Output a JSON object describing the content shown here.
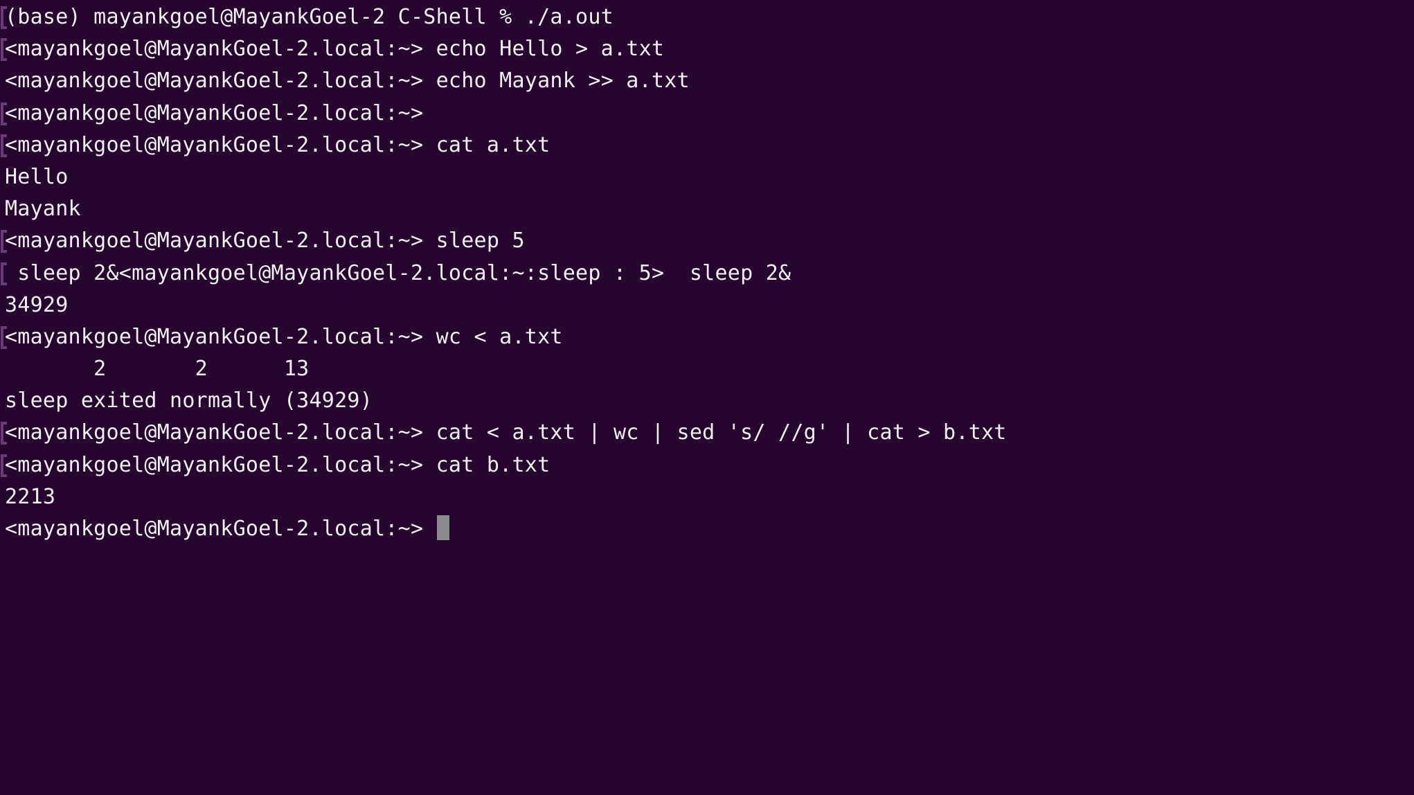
{
  "terminal": {
    "title": "C-Shell",
    "background_color": "#26052e",
    "foreground_color": "#f2f0f5",
    "mark_color": "#6c3a7a",
    "cursor_color": "#8c8c8c",
    "prompt": "<mayankgoel@MayankGoel-2.local:~>",
    "shell_prompt_line": "(base) mayankgoel@MayankGoel-2 C-Shell % ./a.out",
    "lines": [
      {
        "text": "(base) mayankgoel@MayankGoel-2 C-Shell % ./a.out",
        "marked": true,
        "kind": "shell-prompt"
      },
      {
        "text": "<mayankgoel@MayankGoel-2.local:~> echo Hello > a.txt",
        "marked": true,
        "kind": "command"
      },
      {
        "text": "<mayankgoel@MayankGoel-2.local:~> echo Mayank >> a.txt",
        "marked": false,
        "kind": "command"
      },
      {
        "text": "<mayankgoel@MayankGoel-2.local:~>",
        "marked": true,
        "kind": "command"
      },
      {
        "text": "<mayankgoel@MayankGoel-2.local:~> cat a.txt",
        "marked": true,
        "kind": "command"
      },
      {
        "text": "Hello",
        "marked": false,
        "kind": "output"
      },
      {
        "text": "Mayank",
        "marked": false,
        "kind": "output"
      },
      {
        "text": "<mayankgoel@MayankGoel-2.local:~> sleep 5",
        "marked": true,
        "kind": "command"
      },
      {
        "text": " sleep 2&<mayankgoel@MayankGoel-2.local:~:sleep : 5>  sleep 2&",
        "marked": true,
        "kind": "command"
      },
      {
        "text": "34929",
        "marked": false,
        "kind": "output"
      },
      {
        "text": "<mayankgoel@MayankGoel-2.local:~> wc < a.txt",
        "marked": true,
        "kind": "command"
      },
      {
        "text": "       2       2      13",
        "marked": false,
        "kind": "output"
      },
      {
        "text": "sleep exited normally (34929)",
        "marked": false,
        "kind": "output"
      },
      {
        "text": "<mayankgoel@MayankGoel-2.local:~> cat < a.txt | wc | sed 's/ //g' | cat > b.txt",
        "marked": true,
        "kind": "command"
      },
      {
        "text": "<mayankgoel@MayankGoel-2.local:~> cat b.txt",
        "marked": true,
        "kind": "command"
      },
      {
        "text": "2213",
        "marked": false,
        "kind": "output"
      },
      {
        "text": "<mayankgoel@MayankGoel-2.local:~> ",
        "marked": false,
        "kind": "active-prompt",
        "cursor": true
      }
    ]
  }
}
